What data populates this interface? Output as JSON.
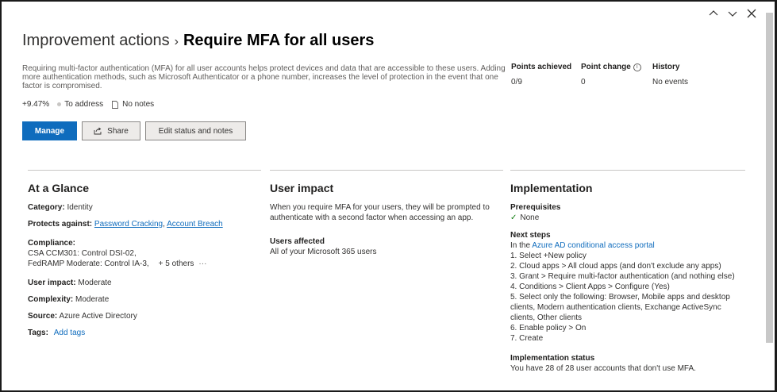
{
  "window": {
    "up_icon": "chevron-up-icon",
    "down_icon": "chevron-down-icon",
    "close_icon": "close-icon"
  },
  "header": {
    "breadcrumb": "Improvement actions",
    "separator": "›",
    "title": "Require MFA for all users",
    "description": "Requiring multi-factor authentication (MFA) for all user accounts helps protect devices and data that are accessible to these users. Adding more authentication methods, such as Microsoft Authenticator or a phone number, increases the level of protection in the event that one factor is compromised.",
    "score": "+9.47%",
    "status": "To address",
    "notes": "No notes"
  },
  "actions": {
    "manage": "Manage",
    "share": "Share",
    "edit": "Edit status and notes"
  },
  "stats": {
    "points_achieved_label": "Points achieved",
    "points_achieved_value": "0/9",
    "point_change_label": "Point change",
    "point_change_value": "0",
    "history_label": "History",
    "history_value": "No events"
  },
  "glance": {
    "title": "At a Glance",
    "category_label": "Category:",
    "category_value": "Identity",
    "protects_label": "Protects against:",
    "protects_links": [
      "Password Cracking",
      "Account Breach"
    ],
    "protects_sep": ",",
    "compliance_label": "Compliance:",
    "compliance_lines": [
      "CSA CCM301: Control DSI-02,",
      "FedRAMP Moderate: Control IA-3,"
    ],
    "compliance_more": "+ 5 others",
    "compliance_ellipsis": "···",
    "user_impact_label": "User impact:",
    "user_impact_value": "Moderate",
    "complexity_label": "Complexity:",
    "complexity_value": "Moderate",
    "source_label": "Source:",
    "source_value": "Azure Active Directory",
    "tags_label": "Tags:",
    "tags_link": "Add tags"
  },
  "user_impact": {
    "title": "User impact",
    "text": "When you require MFA for your users, they will be prompted to authenticate with a second factor when accessing an app.",
    "affected_label": "Users affected",
    "affected_value": "All of your Microsoft 365 users"
  },
  "implementation": {
    "title": "Implementation",
    "prereq_label": "Prerequisites",
    "prereq_value": "None",
    "next_label": "Next steps",
    "next_intro": "In the ",
    "next_link": "Azure AD conditional access portal",
    "steps": [
      "1. Select +New policy",
      "2. Cloud apps > All cloud apps (and don't exclude any apps)",
      "3. Grant > Require multi-factor authentication (and nothing else)",
      "4. Conditions > Client Apps > Configure (Yes)",
      "5. Select only the following: Browser, Mobile apps and desktop clients, Modern authentication clients, Exchange ActiveSync clients, Other clients",
      "6. Enable policy > On",
      "7. Create"
    ],
    "status_label": "Implementation status",
    "status_value": "You have 28 of 28 user accounts that don't use MFA."
  }
}
